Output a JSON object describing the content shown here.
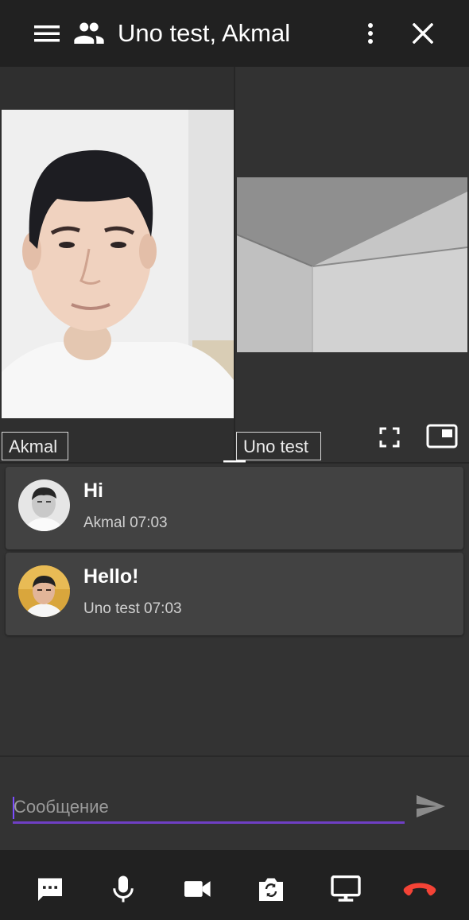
{
  "header": {
    "title": "Uno test, Akmal",
    "icons": [
      "menu-icon",
      "people-icon",
      "more-vert-icon",
      "close-icon"
    ]
  },
  "videos": {
    "left_name": "Akmal",
    "right_name": "Uno test",
    "controls": [
      "fullscreen-icon",
      "picture-in-picture-icon"
    ]
  },
  "messages": [
    {
      "text": "Hi",
      "meta": "Akmal 07:03"
    },
    {
      "text": "Hello!",
      "meta": "Uno test 07:03"
    }
  ],
  "composer": {
    "placeholder": "Сообщение",
    "value": "",
    "accent": "#6f3fc4",
    "send_icon": "send-icon"
  },
  "toolbar": {
    "icons": [
      "chat-icon",
      "microphone-icon",
      "video-camera-icon",
      "switch-camera-icon",
      "screen-share-icon",
      "hang-up-icon"
    ],
    "hangup_color": "#f44336"
  },
  "colors": {
    "header_bg": "#212121",
    "body_bg": "#333333",
    "card_bg": "#424242"
  }
}
